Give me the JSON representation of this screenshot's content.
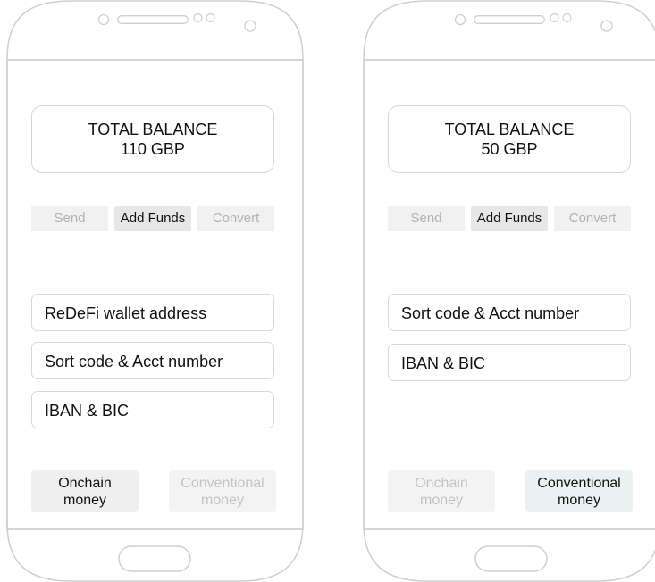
{
  "phones": [
    {
      "balance_label": "TOTAL BALANCE",
      "balance_value": "110 GBP",
      "actions": {
        "send": "Send",
        "add_funds": "Add Funds",
        "convert": "Convert"
      },
      "fields": [
        "ReDeFi wallet address",
        "Sort code & Acct number",
        "IBAN & BIC"
      ],
      "bottom_buttons": {
        "onchain": {
          "line1": "Onchain",
          "line2": "money",
          "active": true
        },
        "conventional": {
          "line1": "Conventional",
          "line2": "money",
          "active": false
        }
      }
    },
    {
      "balance_label": "TOTAL BALANCE",
      "balance_value": "50 GBP",
      "actions": {
        "send": "Send",
        "add_funds": "Add Funds",
        "convert": "Convert"
      },
      "fields": [
        "Sort code & Acct number",
        "IBAN & BIC"
      ],
      "bottom_buttons": {
        "onchain": {
          "line1": "Onchain",
          "line2": "money",
          "active": false
        },
        "conventional": {
          "line1": "Conventional",
          "line2": "money",
          "active": true
        }
      }
    }
  ]
}
